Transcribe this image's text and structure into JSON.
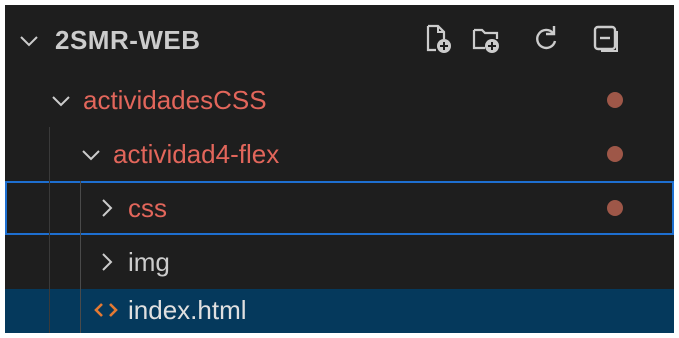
{
  "explorer": {
    "title": "2SMR-WEB",
    "toolbar": {
      "new_file_icon": "new-file-icon",
      "new_folder_icon": "new-folder-icon",
      "refresh_icon": "refresh-icon",
      "collapse_icon": "collapse-all-icon"
    },
    "tree": [
      {
        "label": "actividadesCSS",
        "type": "folder",
        "expanded": true,
        "modified": true
      },
      {
        "label": "actividad4-flex",
        "type": "folder",
        "expanded": true,
        "modified": true
      },
      {
        "label": "css",
        "type": "folder",
        "expanded": false,
        "modified": true,
        "focused": true
      },
      {
        "label": "img",
        "type": "folder",
        "expanded": false,
        "modified": false
      },
      {
        "label": "index.html",
        "type": "file",
        "icon": "html-file-icon",
        "selected": true
      }
    ]
  },
  "colors": {
    "background": "#1e1e1e",
    "modified_text": "#e2665b",
    "modified_dot": "#b56150",
    "focus_border": "#1e6fd0",
    "selection_bg": "#05395c",
    "html_icon": "#e37933"
  }
}
